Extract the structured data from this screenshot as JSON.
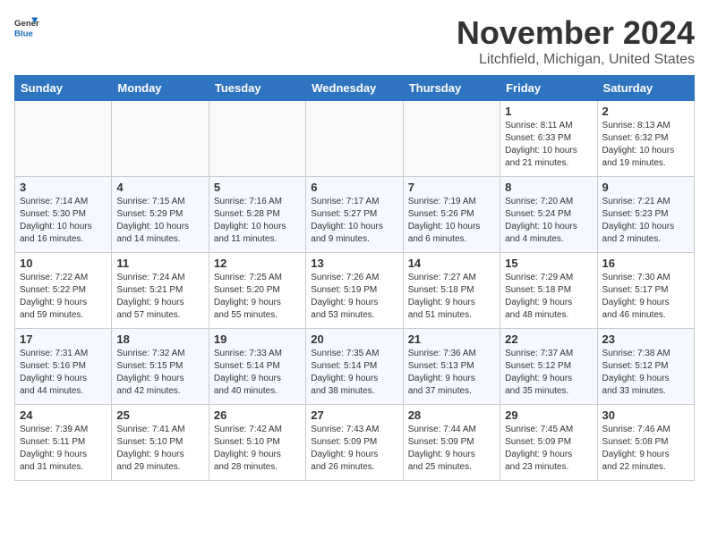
{
  "header": {
    "logo_line1": "General",
    "logo_line2": "Blue",
    "month": "November 2024",
    "location": "Litchfield, Michigan, United States"
  },
  "weekdays": [
    "Sunday",
    "Monday",
    "Tuesday",
    "Wednesday",
    "Thursday",
    "Friday",
    "Saturday"
  ],
  "weeks": [
    [
      {
        "day": "",
        "info": ""
      },
      {
        "day": "",
        "info": ""
      },
      {
        "day": "",
        "info": ""
      },
      {
        "day": "",
        "info": ""
      },
      {
        "day": "",
        "info": ""
      },
      {
        "day": "1",
        "info": "Sunrise: 8:11 AM\nSunset: 6:33 PM\nDaylight: 10 hours\nand 21 minutes."
      },
      {
        "day": "2",
        "info": "Sunrise: 8:13 AM\nSunset: 6:32 PM\nDaylight: 10 hours\nand 19 minutes."
      }
    ],
    [
      {
        "day": "3",
        "info": "Sunrise: 7:14 AM\nSunset: 5:30 PM\nDaylight: 10 hours\nand 16 minutes."
      },
      {
        "day": "4",
        "info": "Sunrise: 7:15 AM\nSunset: 5:29 PM\nDaylight: 10 hours\nand 14 minutes."
      },
      {
        "day": "5",
        "info": "Sunrise: 7:16 AM\nSunset: 5:28 PM\nDaylight: 10 hours\nand 11 minutes."
      },
      {
        "day": "6",
        "info": "Sunrise: 7:17 AM\nSunset: 5:27 PM\nDaylight: 10 hours\nand 9 minutes."
      },
      {
        "day": "7",
        "info": "Sunrise: 7:19 AM\nSunset: 5:26 PM\nDaylight: 10 hours\nand 6 minutes."
      },
      {
        "day": "8",
        "info": "Sunrise: 7:20 AM\nSunset: 5:24 PM\nDaylight: 10 hours\nand 4 minutes."
      },
      {
        "day": "9",
        "info": "Sunrise: 7:21 AM\nSunset: 5:23 PM\nDaylight: 10 hours\nand 2 minutes."
      }
    ],
    [
      {
        "day": "10",
        "info": "Sunrise: 7:22 AM\nSunset: 5:22 PM\nDaylight: 9 hours\nand 59 minutes."
      },
      {
        "day": "11",
        "info": "Sunrise: 7:24 AM\nSunset: 5:21 PM\nDaylight: 9 hours\nand 57 minutes."
      },
      {
        "day": "12",
        "info": "Sunrise: 7:25 AM\nSunset: 5:20 PM\nDaylight: 9 hours\nand 55 minutes."
      },
      {
        "day": "13",
        "info": "Sunrise: 7:26 AM\nSunset: 5:19 PM\nDaylight: 9 hours\nand 53 minutes."
      },
      {
        "day": "14",
        "info": "Sunrise: 7:27 AM\nSunset: 5:18 PM\nDaylight: 9 hours\nand 51 minutes."
      },
      {
        "day": "15",
        "info": "Sunrise: 7:29 AM\nSunset: 5:18 PM\nDaylight: 9 hours\nand 48 minutes."
      },
      {
        "day": "16",
        "info": "Sunrise: 7:30 AM\nSunset: 5:17 PM\nDaylight: 9 hours\nand 46 minutes."
      }
    ],
    [
      {
        "day": "17",
        "info": "Sunrise: 7:31 AM\nSunset: 5:16 PM\nDaylight: 9 hours\nand 44 minutes."
      },
      {
        "day": "18",
        "info": "Sunrise: 7:32 AM\nSunset: 5:15 PM\nDaylight: 9 hours\nand 42 minutes."
      },
      {
        "day": "19",
        "info": "Sunrise: 7:33 AM\nSunset: 5:14 PM\nDaylight: 9 hours\nand 40 minutes."
      },
      {
        "day": "20",
        "info": "Sunrise: 7:35 AM\nSunset: 5:14 PM\nDaylight: 9 hours\nand 38 minutes."
      },
      {
        "day": "21",
        "info": "Sunrise: 7:36 AM\nSunset: 5:13 PM\nDaylight: 9 hours\nand 37 minutes."
      },
      {
        "day": "22",
        "info": "Sunrise: 7:37 AM\nSunset: 5:12 PM\nDaylight: 9 hours\nand 35 minutes."
      },
      {
        "day": "23",
        "info": "Sunrise: 7:38 AM\nSunset: 5:12 PM\nDaylight: 9 hours\nand 33 minutes."
      }
    ],
    [
      {
        "day": "24",
        "info": "Sunrise: 7:39 AM\nSunset: 5:11 PM\nDaylight: 9 hours\nand 31 minutes."
      },
      {
        "day": "25",
        "info": "Sunrise: 7:41 AM\nSunset: 5:10 PM\nDaylight: 9 hours\nand 29 minutes."
      },
      {
        "day": "26",
        "info": "Sunrise: 7:42 AM\nSunset: 5:10 PM\nDaylight: 9 hours\nand 28 minutes."
      },
      {
        "day": "27",
        "info": "Sunrise: 7:43 AM\nSunset: 5:09 PM\nDaylight: 9 hours\nand 26 minutes."
      },
      {
        "day": "28",
        "info": "Sunrise: 7:44 AM\nSunset: 5:09 PM\nDaylight: 9 hours\nand 25 minutes."
      },
      {
        "day": "29",
        "info": "Sunrise: 7:45 AM\nSunset: 5:09 PM\nDaylight: 9 hours\nand 23 minutes."
      },
      {
        "day": "30",
        "info": "Sunrise: 7:46 AM\nSunset: 5:08 PM\nDaylight: 9 hours\nand 22 minutes."
      }
    ]
  ]
}
